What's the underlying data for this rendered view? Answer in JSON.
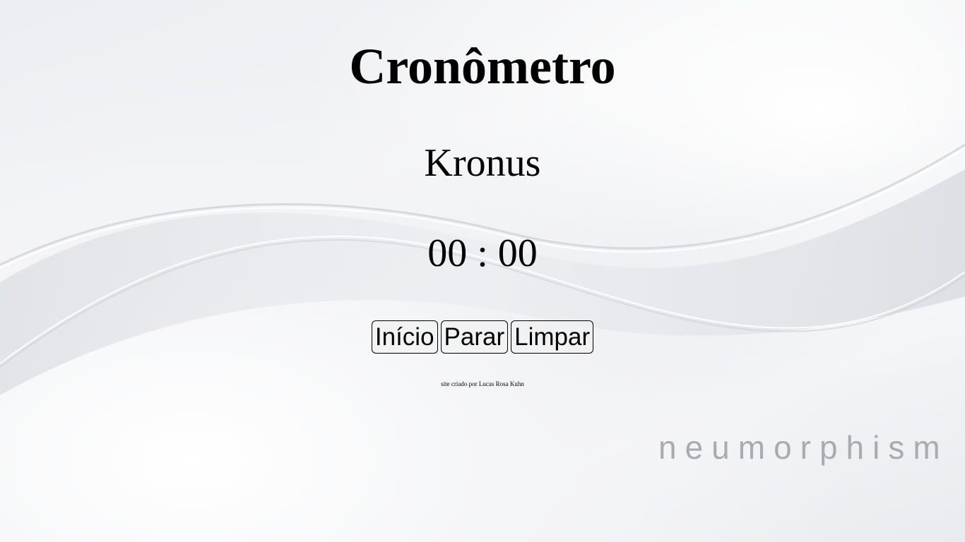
{
  "page": {
    "title": "Cronômetro",
    "subtitle": "Kronus"
  },
  "timer": {
    "display": "00 : 00"
  },
  "controls": {
    "start_label": "Início",
    "stop_label": "Parar",
    "clear_label": "Limpar"
  },
  "footer": {
    "credit": "site criado por Lucas Rosa Kuhn"
  },
  "background": {
    "brand_text": "neumorphism",
    "colors": {
      "base": "#eceef1",
      "wave_line": "#ffffff",
      "wave_shadow": "#cfd2d8",
      "brand_text": "#a9abb0"
    }
  }
}
